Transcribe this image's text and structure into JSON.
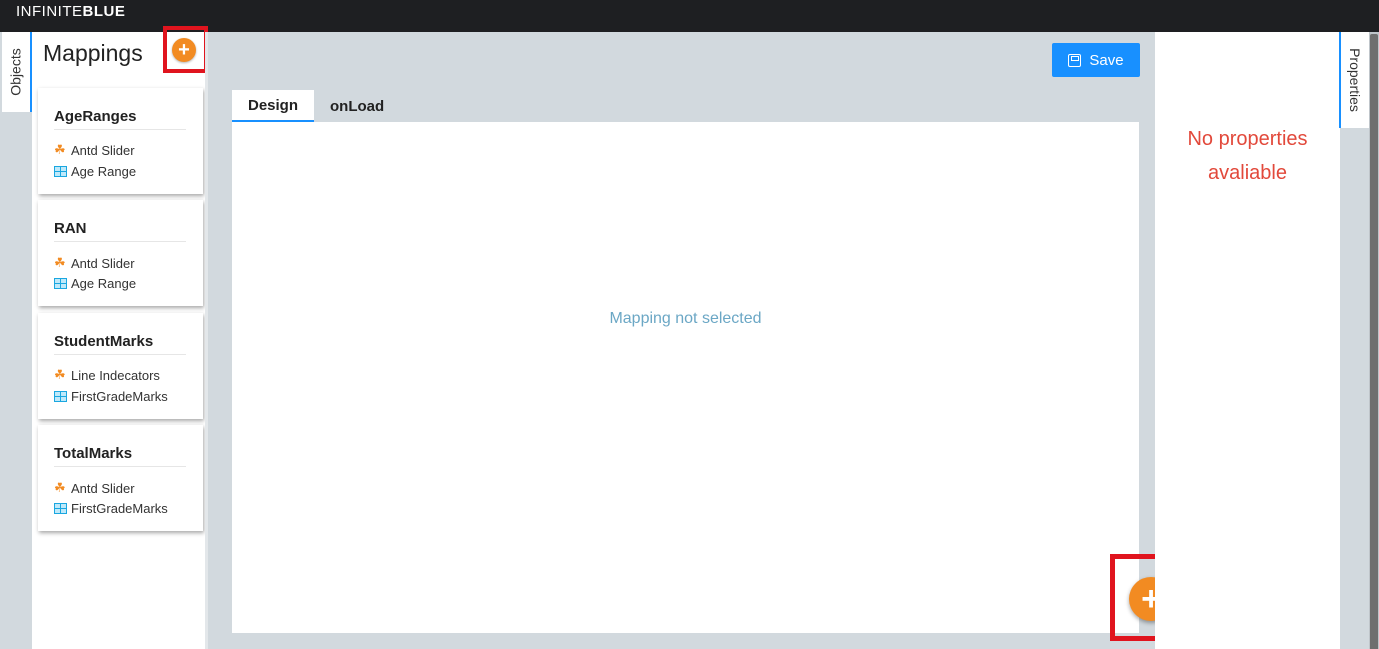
{
  "brand": {
    "part1": "INFINITE",
    "part2": "BLUE"
  },
  "left_tab": {
    "label": "Objects"
  },
  "mappings": {
    "title": "Mappings",
    "add_label": "+",
    "items": [
      {
        "title": "AgeRanges",
        "component": "Antd Slider",
        "table": "Age Range"
      },
      {
        "title": "RAN",
        "component": "Antd Slider",
        "table": "Age Range"
      },
      {
        "title": "StudentMarks",
        "component": "Line Indecators",
        "table": "FirstGradeMarks"
      },
      {
        "title": "TotalMarks",
        "component": "Antd Slider",
        "table": "FirstGradeMarks"
      }
    ]
  },
  "toolbar": {
    "save_label": "Save"
  },
  "tabs": [
    {
      "label": "Design",
      "active": true
    },
    {
      "label": "onLoad",
      "active": false
    }
  ],
  "design": {
    "empty_message": "Mapping not selected",
    "add_label": "+"
  },
  "properties": {
    "tab_label": "Properties",
    "empty_line1": "No properties",
    "empty_line2": "avaliable"
  },
  "colors": {
    "accent": "#1890ff",
    "add_button": "#f28b22",
    "highlight": "#e0141e",
    "empty_props": "#e2493b"
  }
}
